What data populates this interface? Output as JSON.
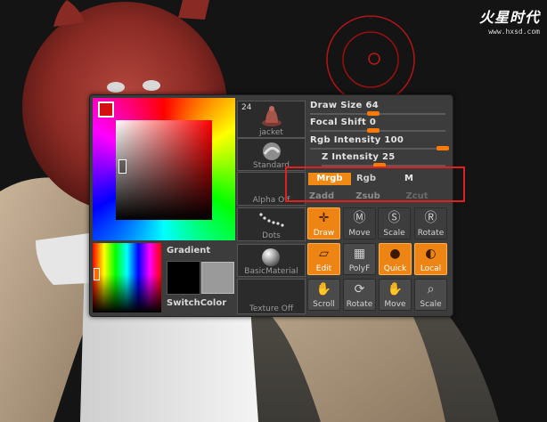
{
  "watermark": {
    "logo": "火星时代",
    "url": "www.hxsd.com"
  },
  "tool": {
    "count": "24",
    "label": "jacket"
  },
  "material_column": {
    "stroke_label": "Standard",
    "alpha_label": "Alpha Off",
    "dots_label": "Dots",
    "material_label": "BasicMaterial",
    "texture_label": "Texture Off"
  },
  "color": {
    "gradient_label": "Gradient",
    "switch_label": "SwitchColor",
    "main_color": "#d41010",
    "secondary_black": "#000000",
    "secondary_gray": "#9a9a9a",
    "accent": "#f08a14"
  },
  "sliders": [
    {
      "label": "Draw Size",
      "value": "64",
      "level": 0.47
    },
    {
      "label": "Focal Shift",
      "value": "0",
      "level": 0.47
    },
    {
      "label": "Rgb Intensity",
      "value": "100",
      "level": 0.98
    },
    {
      "label": "Z Intensity",
      "value": "25",
      "level": 0.47
    }
  ],
  "modes": {
    "mrgb": "Mrgb",
    "rgb": "Rgb",
    "m": "M",
    "zadd": "Zadd",
    "zsub": "Zsub",
    "zcut": "Zcut"
  },
  "buttons": {
    "draw": "Draw",
    "move_top": "Move",
    "scale_top": "Scale",
    "rotate_top": "Rotate",
    "edit": "Edit",
    "polyf": "PolyF",
    "quick": "Quick",
    "local": "Local",
    "scroll": "Scroll",
    "rotate": "Rotate",
    "move": "Move",
    "scale": "Scale"
  }
}
